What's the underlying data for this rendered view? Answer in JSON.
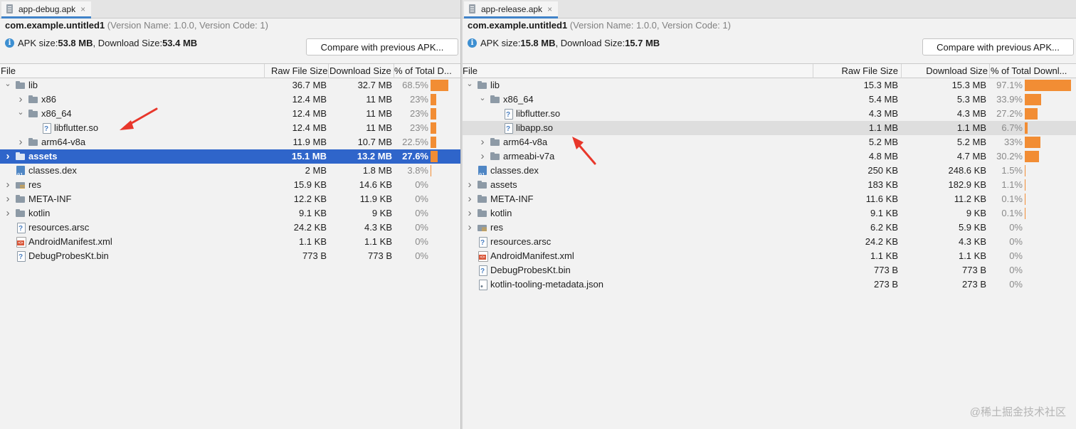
{
  "left": {
    "tab_title": "app-debug.apk",
    "tab_close": "×",
    "package": "com.example.untitled1",
    "version": "(Version Name: 1.0.0, Version Code: 1)",
    "apk_size_label": "APK size: ",
    "apk_size": "53.8 MB",
    "download_size_label": ", Download Size: ",
    "download_size": "53.4 MB",
    "compare_button": "Compare with previous APK...",
    "columns": [
      "File",
      "Raw File Size",
      "Download Size",
      "% of Total D..."
    ],
    "rows": [
      {
        "name": "lib",
        "depth": 0,
        "arrow": "down",
        "icon": "folder",
        "raw": "36.7 MB",
        "download": "32.7 MB",
        "pct": "68.5%",
        "bar": 68.5
      },
      {
        "name": "x86",
        "depth": 1,
        "arrow": "right",
        "icon": "folder",
        "raw": "12.4 MB",
        "download": "11 MB",
        "pct": "23%",
        "bar": 23
      },
      {
        "name": "x86_64",
        "depth": 1,
        "arrow": "down",
        "icon": "folder",
        "raw": "12.4 MB",
        "download": "11 MB",
        "pct": "23%",
        "bar": 23
      },
      {
        "name": "libflutter.so",
        "depth": 2,
        "arrow": "none",
        "icon": "file",
        "raw": "12.4 MB",
        "download": "11 MB",
        "pct": "23%",
        "bar": 23
      },
      {
        "name": "arm64-v8a",
        "depth": 1,
        "arrow": "right",
        "icon": "folder",
        "raw": "11.9 MB",
        "download": "10.7 MB",
        "pct": "22.5%",
        "bar": 22.5
      },
      {
        "name": "assets",
        "depth": 0,
        "arrow": "right",
        "icon": "folder",
        "raw": "15.1 MB",
        "download": "13.2 MB",
        "pct": "27.6%",
        "bar": 27.6,
        "selected": true
      },
      {
        "name": "classes.dex",
        "depth": 0,
        "arrow": "none",
        "icon": "dex",
        "raw": "2 MB",
        "download": "1.8 MB",
        "pct": "3.8%",
        "bar": 3.8
      },
      {
        "name": "res",
        "depth": 0,
        "arrow": "right",
        "icon": "res",
        "raw": "15.9 KB",
        "download": "14.6 KB",
        "pct": "0%",
        "bar": 0
      },
      {
        "name": "META-INF",
        "depth": 0,
        "arrow": "right",
        "icon": "folder",
        "raw": "12.2 KB",
        "download": "11.9 KB",
        "pct": "0%",
        "bar": 0
      },
      {
        "name": "kotlin",
        "depth": 0,
        "arrow": "right",
        "icon": "folder",
        "raw": "9.1 KB",
        "download": "9 KB",
        "pct": "0%",
        "bar": 0
      },
      {
        "name": "resources.arsc",
        "depth": 0,
        "arrow": "none",
        "icon": "file",
        "raw": "24.2 KB",
        "download": "4.3 KB",
        "pct": "0%",
        "bar": 0
      },
      {
        "name": "AndroidManifest.xml",
        "depth": 0,
        "arrow": "none",
        "icon": "xml",
        "raw": "1.1 KB",
        "download": "1.1 KB",
        "pct": "0%",
        "bar": 0
      },
      {
        "name": "DebugProbesKt.bin",
        "depth": 0,
        "arrow": "none",
        "icon": "file",
        "raw": "773 B",
        "download": "773 B",
        "pct": "0%",
        "bar": 0
      }
    ]
  },
  "right": {
    "tab_title": "app-release.apk",
    "tab_close": "×",
    "package": "com.example.untitled1",
    "version": "(Version Name: 1.0.0, Version Code: 1)",
    "apk_size_label": "APK size: ",
    "apk_size": "15.8 MB",
    "download_size_label": ", Download Size: ",
    "download_size": "15.7 MB",
    "compare_button": "Compare with previous APK...",
    "columns": [
      "File",
      "Raw File Size",
      "Download Size",
      "% of Total Downl..."
    ],
    "rows": [
      {
        "name": "lib",
        "depth": 0,
        "arrow": "down",
        "icon": "folder",
        "raw": "15.3 MB",
        "download": "15.3 MB",
        "pct": "97.1%",
        "bar": 97.1
      },
      {
        "name": "x86_64",
        "depth": 1,
        "arrow": "down",
        "icon": "folder",
        "raw": "5.4 MB",
        "download": "5.3 MB",
        "pct": "33.9%",
        "bar": 33.9
      },
      {
        "name": "libflutter.so",
        "depth": 2,
        "arrow": "none",
        "icon": "file",
        "raw": "4.3 MB",
        "download": "4.3 MB",
        "pct": "27.2%",
        "bar": 27.2
      },
      {
        "name": "libapp.so",
        "depth": 2,
        "arrow": "none",
        "icon": "file",
        "raw": "1.1 MB",
        "download": "1.1 MB",
        "pct": "6.7%",
        "bar": 6.7,
        "hover": true
      },
      {
        "name": "arm64-v8a",
        "depth": 1,
        "arrow": "right",
        "icon": "folder",
        "raw": "5.2 MB",
        "download": "5.2 MB",
        "pct": "33%",
        "bar": 33
      },
      {
        "name": "armeabi-v7a",
        "depth": 1,
        "arrow": "right",
        "icon": "folder",
        "raw": "4.8 MB",
        "download": "4.7 MB",
        "pct": "30.2%",
        "bar": 30.2
      },
      {
        "name": "classes.dex",
        "depth": 0,
        "arrow": "none",
        "icon": "dex",
        "raw": "250 KB",
        "download": "248.6 KB",
        "pct": "1.5%",
        "bar": 1.5
      },
      {
        "name": "assets",
        "depth": 0,
        "arrow": "right",
        "icon": "folder",
        "raw": "183 KB",
        "download": "182.9 KB",
        "pct": "1.1%",
        "bar": 1.1
      },
      {
        "name": "META-INF",
        "depth": 0,
        "arrow": "right",
        "icon": "folder",
        "raw": "11.6 KB",
        "download": "11.2 KB",
        "pct": "0.1%",
        "bar": 0.1
      },
      {
        "name": "kotlin",
        "depth": 0,
        "arrow": "right",
        "icon": "folder",
        "raw": "9.1 KB",
        "download": "9 KB",
        "pct": "0.1%",
        "bar": 0.1
      },
      {
        "name": "res",
        "depth": 0,
        "arrow": "right",
        "icon": "res",
        "raw": "6.2 KB",
        "download": "5.9 KB",
        "pct": "0%",
        "bar": 0
      },
      {
        "name": "resources.arsc",
        "depth": 0,
        "arrow": "none",
        "icon": "file",
        "raw": "24.2 KB",
        "download": "4.3 KB",
        "pct": "0%",
        "bar": 0
      },
      {
        "name": "AndroidManifest.xml",
        "depth": 0,
        "arrow": "none",
        "icon": "xml",
        "raw": "1.1 KB",
        "download": "1.1 KB",
        "pct": "0%",
        "bar": 0
      },
      {
        "name": "DebugProbesKt.bin",
        "depth": 0,
        "arrow": "none",
        "icon": "file",
        "raw": "773 B",
        "download": "773 B",
        "pct": "0%",
        "bar": 0
      },
      {
        "name": "kotlin-tooling-metadata.json",
        "depth": 0,
        "arrow": "none",
        "icon": "json",
        "raw": "273 B",
        "download": "273 B",
        "pct": "0%",
        "bar": 0
      }
    ]
  },
  "watermark": "@稀土掘金技术社区",
  "colors": {
    "selection": "#2f65ca",
    "bar": "#f28d34",
    "annotation": "#e8372b",
    "tab_underline": "#4083c9"
  }
}
